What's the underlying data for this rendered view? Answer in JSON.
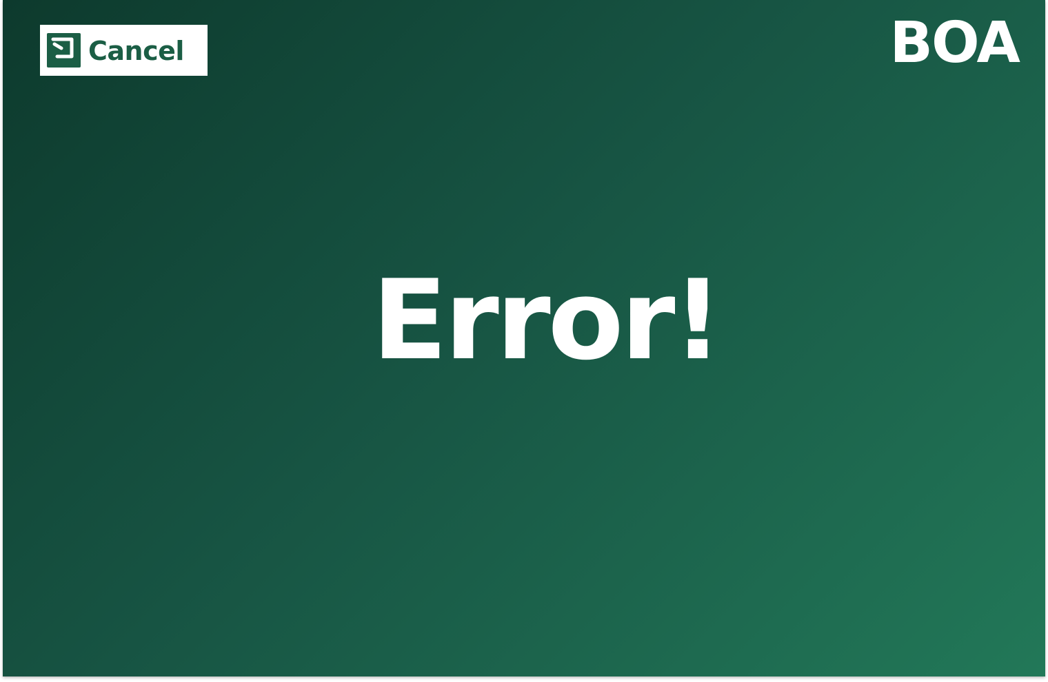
{
  "header": {
    "cancel_label": "Cancel",
    "cancel_icon": "return-arrow-icon",
    "brand": "BOA"
  },
  "main": {
    "message": "Error!"
  },
  "colors": {
    "background_start": "#0d3a2d",
    "background_end": "#227858",
    "accent": "#1b5e45",
    "text": "#ffffff"
  }
}
